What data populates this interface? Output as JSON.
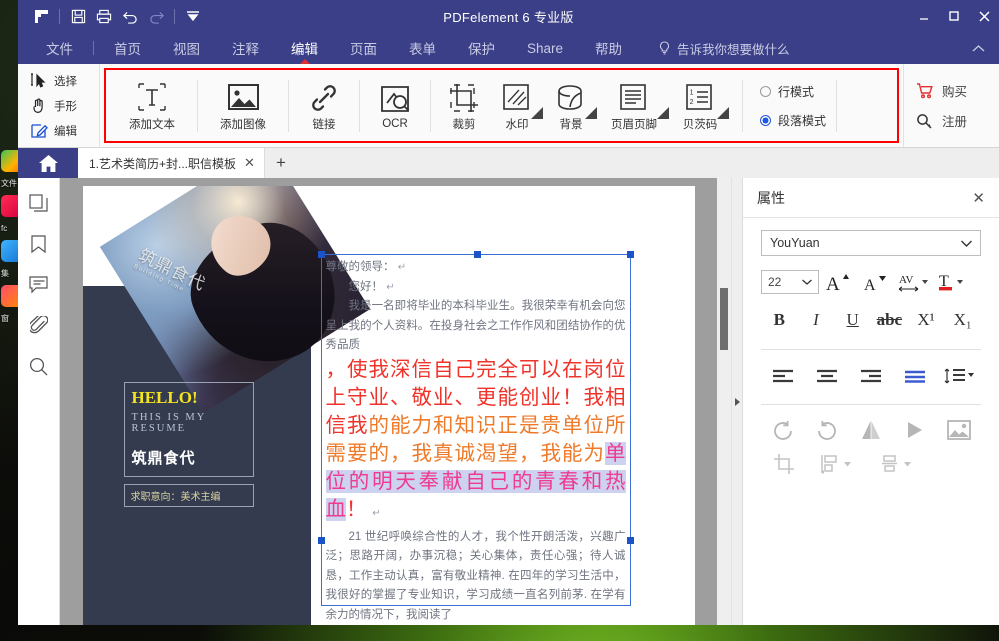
{
  "window": {
    "title": "PDFelement 6 专业版",
    "quick_access": [
      "app-logo",
      "save-icon",
      "print-icon",
      "undo-icon",
      "redo-icon",
      "customize-qat-icon"
    ],
    "controls": {
      "minimize": "—",
      "maximize": "◻",
      "close": "✕"
    }
  },
  "ribbon_tabs": [
    {
      "label": "文件",
      "active": false
    },
    {
      "label": "首页",
      "active": false
    },
    {
      "label": "视图",
      "active": false
    },
    {
      "label": "注释",
      "active": false
    },
    {
      "label": "编辑",
      "active": true
    },
    {
      "label": "页面",
      "active": false
    },
    {
      "label": "表单",
      "active": false
    },
    {
      "label": "保护",
      "active": false
    },
    {
      "label": "Share",
      "active": false
    },
    {
      "label": "帮助",
      "active": false
    }
  ],
  "tell_me": {
    "label": "告诉我你想要做什么",
    "icon": "lightbulb-icon"
  },
  "ribbon_collapse": {
    "icon": "chevron-up-icon"
  },
  "mode_tools": [
    {
      "label": "选择",
      "icon": "select-cursor-icon"
    },
    {
      "label": "手形",
      "icon": "hand-icon"
    },
    {
      "label": "编辑",
      "icon": "edit-pencil-icon"
    }
  ],
  "ribbon_buttons": [
    {
      "label": "添加文本",
      "icon": "add-text-icon",
      "has_dropdown": false
    },
    {
      "label": "添加图像",
      "icon": "add-image-icon",
      "has_dropdown": false
    },
    {
      "label": "链接",
      "icon": "link-icon",
      "has_dropdown": false
    },
    {
      "label": "OCR",
      "icon": "ocr-icon",
      "has_dropdown": false
    },
    {
      "label": "裁剪",
      "icon": "crop-icon",
      "has_dropdown": false
    },
    {
      "label": "水印",
      "icon": "watermark-icon",
      "has_dropdown": true
    },
    {
      "label": "背景",
      "icon": "background-icon",
      "has_dropdown": true
    },
    {
      "label": "页眉页脚",
      "icon": "header-footer-icon",
      "has_dropdown": true
    },
    {
      "label": "贝茨码",
      "icon": "bates-numbering-icon",
      "has_dropdown": true
    }
  ],
  "edit_mode": {
    "options": [
      {
        "label": "行模式",
        "selected": false
      },
      {
        "label": "段落模式",
        "selected": true
      }
    ]
  },
  "account": [
    {
      "label": "购买",
      "icon": "cart-icon",
      "color": "#e03030"
    },
    {
      "label": "注册",
      "icon": "key-icon",
      "color": "#333333"
    }
  ],
  "doc_tabs": {
    "home_icon": "home-icon",
    "tabs": [
      {
        "label": "1.艺术类简历+封...职信模板",
        "close": "✕",
        "active": true
      }
    ],
    "new_tab": "+"
  },
  "left_nav": [
    {
      "name": "thumbnails-icon"
    },
    {
      "name": "bookmark-icon"
    },
    {
      "name": "comment-icon"
    },
    {
      "name": "attachment-icon"
    },
    {
      "name": "search-icon"
    }
  ],
  "document": {
    "cover": {
      "photo_caption": "筑鼎食代",
      "photo_caption_sub": "Building Time",
      "hello": "HELLO!",
      "subtitle": "THIS IS MY RESUME",
      "name": "筑鼎食代",
      "intent": "求职意向：美术主编"
    },
    "text_block": {
      "line1": "尊敬的领导：",
      "line2": "您好！",
      "para1": "我是一名即将毕业的本科毕业生。我很荣幸有机会向您呈上我的个人资料。在投身社会之工作作风和团结协作的优秀品质",
      "big_red_1": "，使我深信自己完全可以在岗位上守业、敬业、更能创业！我相信我",
      "big_orange": "的能力和知识正是贵单位所需要的，我真诚渴望，我能为",
      "big_selected": "单位的明天奉献自己的青春和热血",
      "big_excl": "！",
      "para2": "21 世纪呼唤综合性的人才，我个性开朗活泼，兴趣广泛；思路开阔，办事沉稳；关心集体，责任心强；待人诚恳，工作主动认真，富有敬业精神. 在四年的学习生活中，我很好的掌握了专业知识，学习成绩一直名列前茅. 在学有余力的情况下，我阅读了",
      "pilcrow": "↵"
    }
  },
  "properties_panel": {
    "title": "属性",
    "close": "✕",
    "font": {
      "value": "YouYuan",
      "dropdown_icon": "chevron-down-icon"
    },
    "size": {
      "value": "22",
      "dropdown_icon": "chevron-down-icon"
    },
    "size_tools": [
      {
        "name": "increase-font-size-icon",
        "label": "A"
      },
      {
        "name": "decrease-font-size-icon",
        "label": "A"
      },
      {
        "name": "character-spacing-icon",
        "label": "AV"
      },
      {
        "name": "font-color-icon",
        "label": "T",
        "color": "#e02020"
      }
    ],
    "style_tools": [
      {
        "name": "bold-icon",
        "label": "B"
      },
      {
        "name": "italic-icon",
        "label": "I"
      },
      {
        "name": "underline-icon",
        "label": "U"
      },
      {
        "name": "strikethrough-icon",
        "label": "abc"
      },
      {
        "name": "superscript-icon",
        "label": "X¹"
      },
      {
        "name": "subscript-icon",
        "label": "X₁"
      }
    ],
    "align_tools": [
      {
        "name": "align-left-icon",
        "selected": false
      },
      {
        "name": "align-center-icon",
        "selected": false
      },
      {
        "name": "align-right-icon",
        "selected": false
      },
      {
        "name": "align-justify-icon",
        "selected": true
      },
      {
        "name": "line-spacing-icon",
        "selected": false
      }
    ],
    "image_tools": [
      {
        "name": "rotate-left-icon"
      },
      {
        "name": "rotate-right-icon"
      },
      {
        "name": "flip-horizontal-icon"
      },
      {
        "name": "flip-vertical-icon"
      },
      {
        "name": "replace-image-icon"
      }
    ],
    "image_tools2": [
      {
        "name": "crop-image-icon"
      },
      {
        "name": "align-objects-icon"
      },
      {
        "name": "distribute-objects-icon"
      }
    ]
  },
  "colors": {
    "titlebar": "#3a3f87",
    "highlight_box": "#ff0000",
    "accent_blue": "#2255dd",
    "selection": "#ccd2ef",
    "red_text": "#f0332a",
    "orange_text": "#ee7a2a",
    "pink_text": "#f03a8f"
  }
}
